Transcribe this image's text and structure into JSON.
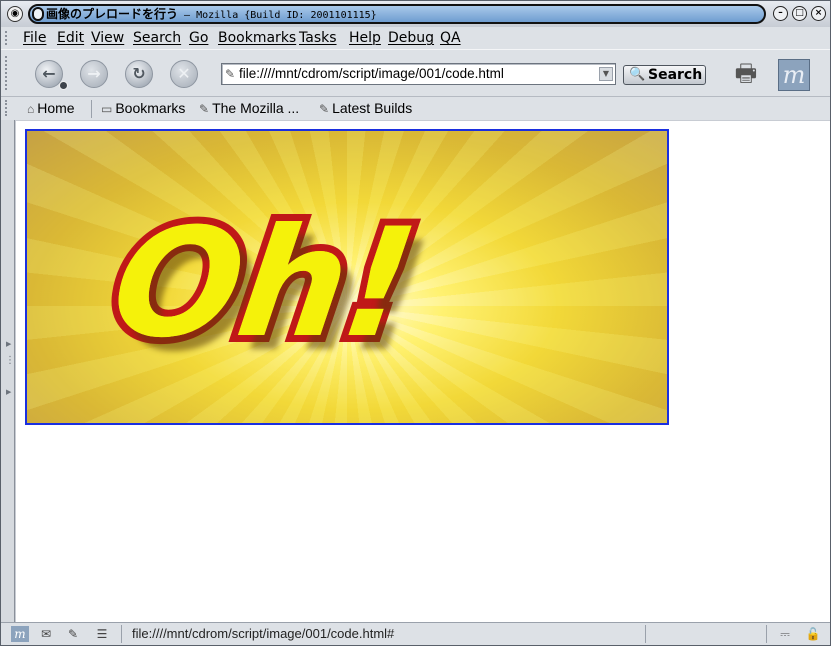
{
  "window": {
    "title": "画像のプレロードを行う",
    "title_suffix": " – Mozilla {Build ID: 2001101115}",
    "minimize_glyph": "–",
    "maximize_glyph": "□",
    "close_glyph": "×"
  },
  "menu": {
    "items": [
      "File",
      "Edit",
      "View",
      "Search",
      "Go",
      "Bookmarks",
      "Tasks",
      "Help",
      "Debug",
      "QA"
    ]
  },
  "nav": {
    "back_glyph": "←",
    "forward_glyph": "→",
    "reload_glyph": "↻",
    "stop_glyph": "✕",
    "url_value": "file:////mnt/cdrom/script/image/001/code.html",
    "url_icon": "✎",
    "search_label": "Search",
    "search_icon": "🔍"
  },
  "personal_toolbar": {
    "items": [
      {
        "label": "Home",
        "icon": "⌂"
      },
      {
        "label": "Bookmarks",
        "icon": "▭"
      },
      {
        "label": "The Mozilla ...",
        "icon": "✎"
      },
      {
        "label": "Latest Builds",
        "icon": "✎"
      }
    ]
  },
  "content": {
    "banner_text": "Oh!"
  },
  "status": {
    "text": "file:////mnt/cdrom/script/image/001/code.html#"
  },
  "colors": {
    "banner_border": "#1a2fe0",
    "banner_text_fill": "#f5f20a",
    "banner_text_outline": "#c01818"
  }
}
